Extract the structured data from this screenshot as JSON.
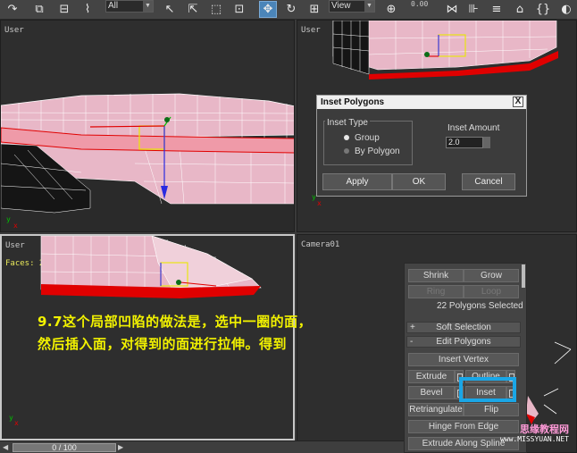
{
  "toolbar": {
    "filter_value": "All",
    "refcoord_value": "View",
    "spinner_value": "0.00"
  },
  "viewports": {
    "top_left": {
      "label": "User"
    },
    "top_right": {
      "label": "User"
    },
    "bottom_left": {
      "label": "User",
      "faces": "Faces: 28"
    },
    "bottom_right": {
      "label": "Camera01"
    }
  },
  "dialog": {
    "title": "Inset Polygons",
    "close": "X",
    "group_title": "Inset Type",
    "options": [
      "Group",
      "By Polygon"
    ],
    "selected_option": "Group",
    "amount_label": "Inset Amount",
    "amount_value": "2.0",
    "buttons": {
      "apply": "Apply",
      "ok": "OK",
      "cancel": "Cancel"
    }
  },
  "panel": {
    "shrink": "Shrink",
    "grow": "Grow",
    "ring": "Ring",
    "loop": "Loop",
    "selected_text": "22 Polygons Selected",
    "soft_selection": {
      "sign": "+",
      "label": "Soft Selection"
    },
    "edit_polygons": {
      "sign": "-",
      "label": "Edit Polygons"
    },
    "insert_vertex": "Insert Vertex",
    "extrude": "Extrude",
    "outline": "Outline",
    "bevel": "Bevel",
    "inset": "Inset",
    "retriangulate": "Retriangulate",
    "flip": "Flip",
    "hinge": "Hinge From Edge",
    "extrude_spline": "Extrude Along Spline"
  },
  "caption": {
    "line1": "9.7这个局部凹陷的做法是，选中一圈的面，",
    "line2": "然后插入面，对得到的面进行拉伸。得到"
  },
  "timebar": {
    "frame": "0 / 100"
  },
  "watermark": {
    "line1": "思缘教程网",
    "line2": "www.MISSYUAN.NET"
  },
  "colors": {
    "accent": "#1aa6e6",
    "caption": "#f2f200",
    "mesh": "#e8b7c7",
    "selection": "#e00000"
  }
}
